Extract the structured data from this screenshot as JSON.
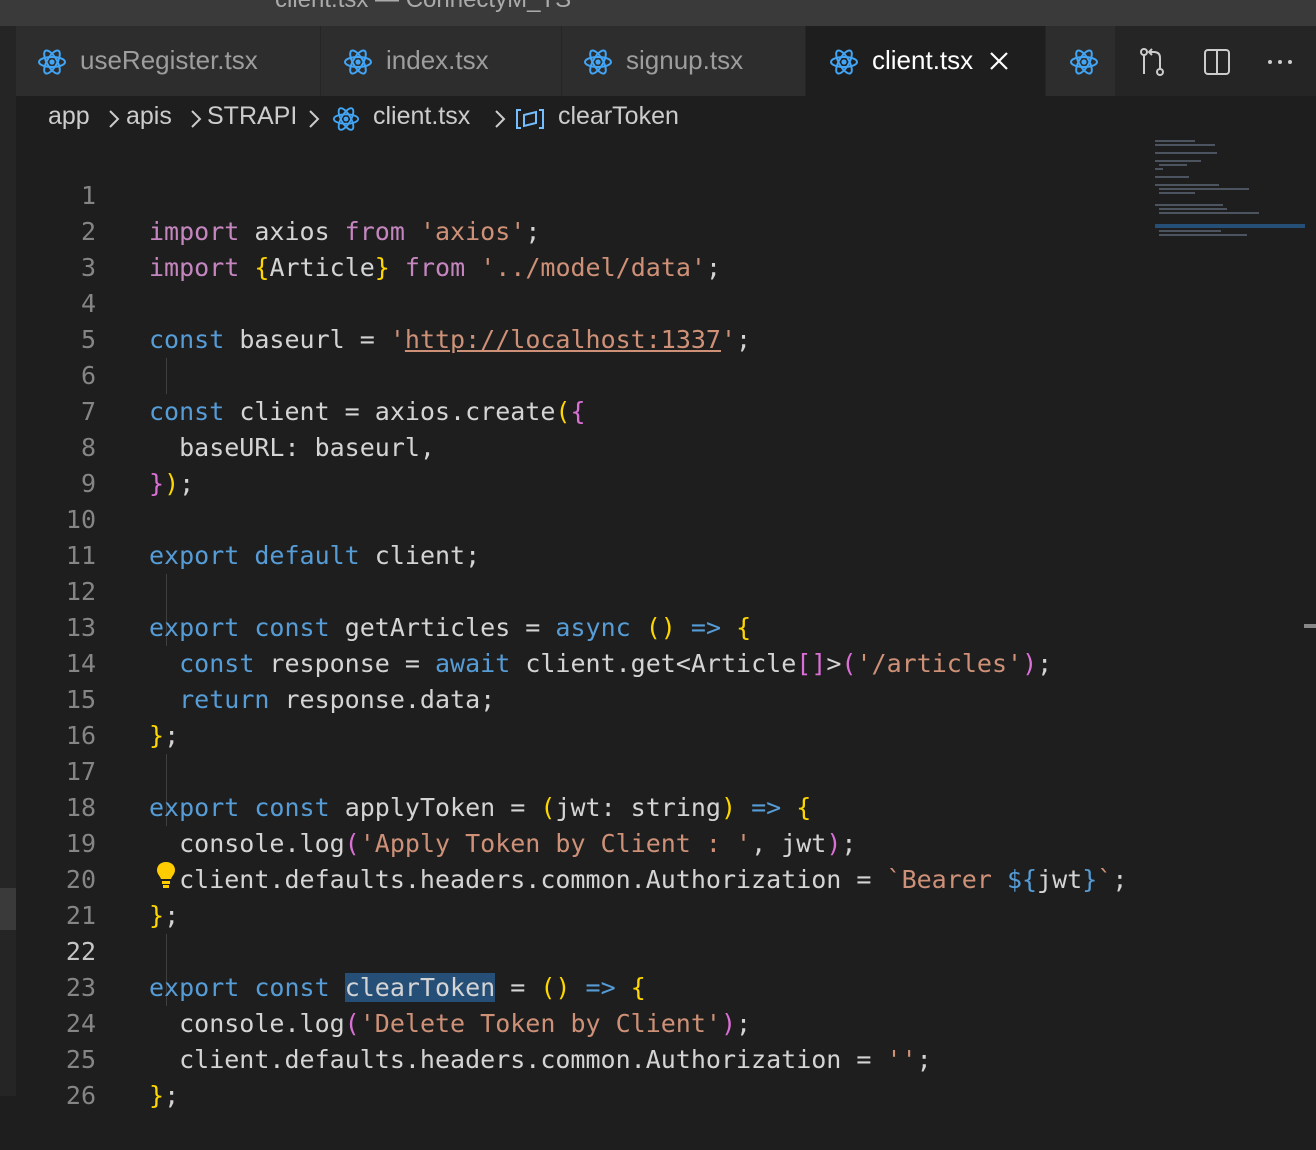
{
  "window": {
    "title": "client.tsx — ConnectyM_TS"
  },
  "tabs": [
    {
      "label": "useRegister.tsx",
      "icon": "react-icon",
      "active": false
    },
    {
      "label": "index.tsx",
      "icon": "react-icon",
      "active": false
    },
    {
      "label": "signup.tsx",
      "icon": "react-icon",
      "active": false
    },
    {
      "label": "client.tsx",
      "icon": "react-icon",
      "active": true
    }
  ],
  "tab_actions": [
    "compare-changes-icon",
    "split-editor-icon",
    "more-actions-icon"
  ],
  "breadcrumb": {
    "items": [
      "app",
      "apis",
      "STRAPI",
      "client.tsx",
      "clearToken"
    ]
  },
  "editor": {
    "current_line": 22,
    "lines": [
      {
        "n": "1",
        "text": "import axios from 'axios';"
      },
      {
        "n": "2",
        "text": "import {Article} from '../model/data';"
      },
      {
        "n": "3",
        "text": ""
      },
      {
        "n": "4",
        "text": "const baseurl = 'http://localhost:1337';"
      },
      {
        "n": "5",
        "text": ""
      },
      {
        "n": "6",
        "text": "const client = axios.create({"
      },
      {
        "n": "7",
        "text": "  baseURL: baseurl,"
      },
      {
        "n": "8",
        "text": "});"
      },
      {
        "n": "9",
        "text": ""
      },
      {
        "n": "10",
        "text": "export default client;"
      },
      {
        "n": "11",
        "text": ""
      },
      {
        "n": "12",
        "text": "export const getArticles = async () => {"
      },
      {
        "n": "13",
        "text": "  const response = await client.get<Article[]>('/articles');"
      },
      {
        "n": "14",
        "text": "  return response.data;"
      },
      {
        "n": "15",
        "text": "};"
      },
      {
        "n": "16",
        "text": ""
      },
      {
        "n": "17",
        "text": "export const applyToken = (jwt: string) => {"
      },
      {
        "n": "18",
        "text": "  console.log('Apply Token by Client : ', jwt);"
      },
      {
        "n": "19",
        "text": "  client.defaults.headers.common.Authorization = `Bearer ${jwt}`;"
      },
      {
        "n": "20",
        "text": "};"
      },
      {
        "n": "21",
        "text": ""
      },
      {
        "n": "22",
        "text": "export const clearToken = () => {"
      },
      {
        "n": "23",
        "text": "  console.log('Delete Token by Client');"
      },
      {
        "n": "24",
        "text": "  client.defaults.headers.common.Authorization = '';"
      },
      {
        "n": "25",
        "text": "};"
      },
      {
        "n": "26",
        "text": ""
      }
    ]
  },
  "colors": {
    "keyword": "#569cd6",
    "control": "#c586c0",
    "string": "#ce9178",
    "function": "#dcdcaa",
    "type": "#4ec9b0",
    "bracket1": "#ffd700",
    "bracket2": "#da70d6",
    "bracket3": "#179fff",
    "background": "#1e1e1e"
  }
}
